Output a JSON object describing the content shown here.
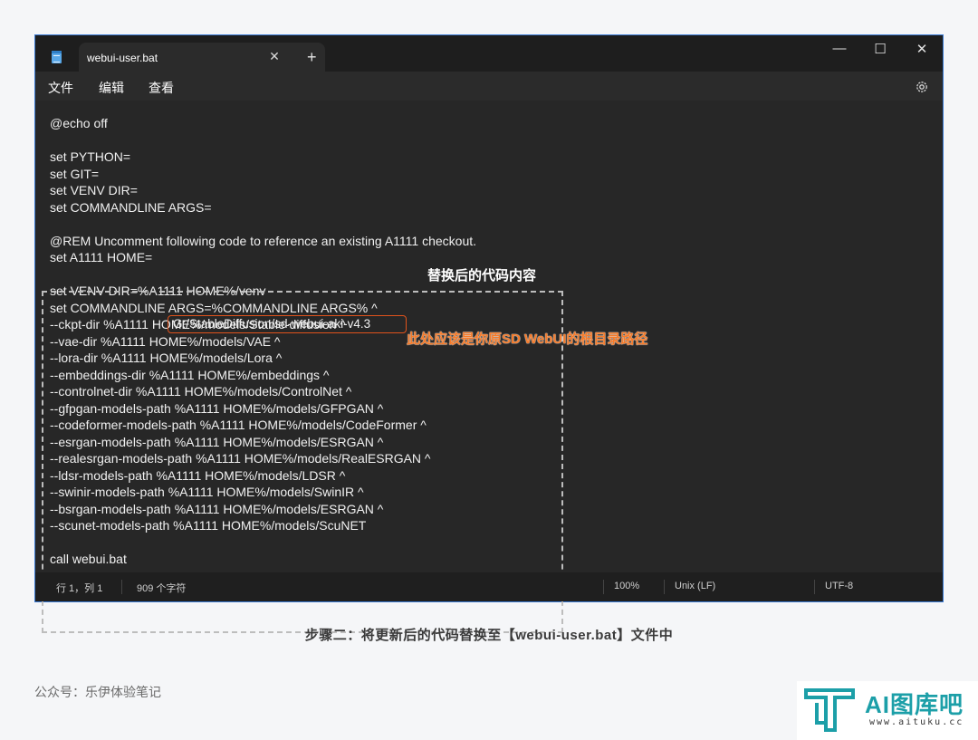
{
  "window": {
    "tab_title": "webui-user.bat",
    "tab_close": "✕",
    "new_tab": "+",
    "minimize": "—",
    "maximize": "☐",
    "close": "✕"
  },
  "menu": {
    "file": "文件",
    "edit": "编辑",
    "view": "查看"
  },
  "editor": {
    "lines": [
      "@echo off",
      "",
      "set PYTHON=",
      "set GIT=",
      "set VENV DIR=",
      "set COMMANDLINE ARGS=",
      "",
      "@REM Uncomment following code to reference an existing A1111 checkout.",
      "set A1111 HOME=",
      "",
      "set VENV DIR=%A1111 HOME%/venv",
      "set COMMANDLINE ARGS=%COMMANDLINE ARGS% ^",
      "--ckpt-dir %A1111 HOME%/models/Stable-diffusion ^",
      "--vae-dir %A1111 HOME%/models/VAE ^",
      "--lora-dir %A1111 HOME%/models/Lora ^",
      "--embeddings-dir %A1111 HOME%/embeddings ^",
      "--controlnet-dir %A1111 HOME%/models/ControlNet ^",
      "--gfpgan-models-path %A1111 HOME%/models/GFPGAN ^",
      "--codeformer-models-path %A1111 HOME%/models/CodeFormer ^",
      "--esrgan-models-path %A1111 HOME%/models/ESRGAN ^",
      "--realesrgan-models-path %A1111 HOME%/models/RealESRGAN ^",
      "--ldsr-models-path %A1111 HOME%/models/LDSR ^",
      "--swinir-models-path %A1111 HOME%/models/SwinIR ^",
      "--bsrgan-models-path %A1111 HOME%/models/ESRGAN ^",
      "--scunet-models-path %A1111 HOME%/models/ScuNET",
      "",
      "call webui.bat"
    ],
    "highlighted_path": "G:/StableDiffusion/sd-webui-aki-v4.3"
  },
  "annotations": {
    "replaced_code": "替换后的代码内容",
    "path_note": "此处应该是你原SD WebUI的根目录路径"
  },
  "status": {
    "position": "行 1，列 1",
    "char_count": "909 个字符",
    "zoom": "100%",
    "line_ending": "Unix (LF)",
    "encoding": "UTF-8"
  },
  "caption": "步骤二：将更新后的代码替换至【webui-user.bat】文件中",
  "footer": {
    "account": "公众号：乐伊体验笔记",
    "logo_text": "AI图库吧",
    "logo_url": "www.aituku.cc"
  },
  "colors": {
    "highlight_border": "#e0531c",
    "annotation_orange": "#f57b2a",
    "logo_teal": "#1c9fa8"
  }
}
